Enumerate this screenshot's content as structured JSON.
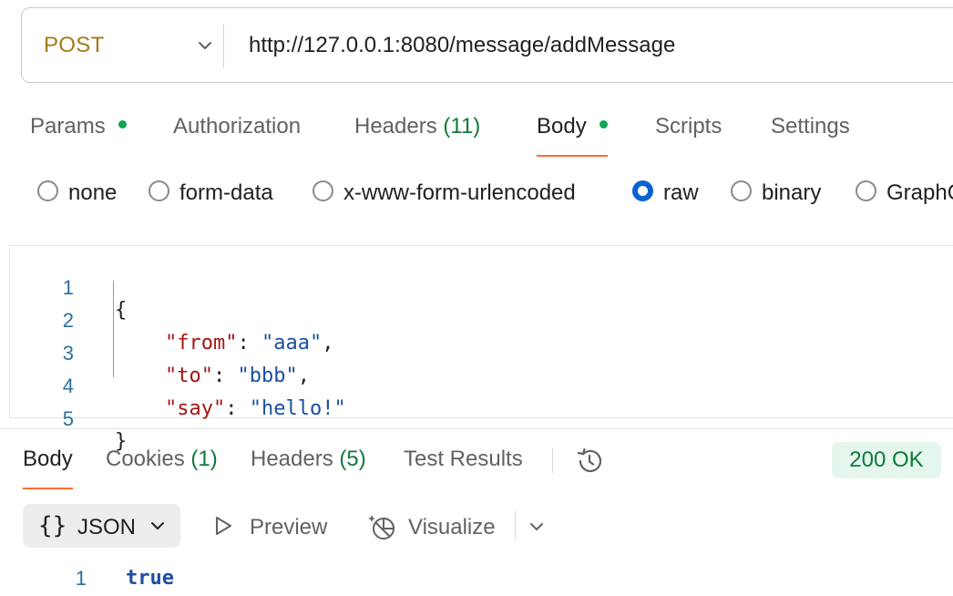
{
  "request": {
    "method": "POST",
    "url": "http://127.0.0.1:8080/message/addMessage"
  },
  "request_tabs": [
    {
      "label": "Params",
      "has_dot": true
    },
    {
      "label": "Authorization"
    },
    {
      "label": "Headers",
      "count": "(11)"
    },
    {
      "label": "Body",
      "has_dot": true,
      "active": true
    },
    {
      "label": "Scripts"
    },
    {
      "label": "Settings"
    }
  ],
  "body_types": [
    {
      "label": "none",
      "checked": false
    },
    {
      "label": "form-data",
      "checked": false
    },
    {
      "label": "x-www-form-urlencoded",
      "checked": false
    },
    {
      "label": "raw",
      "checked": true
    },
    {
      "label": "binary",
      "checked": false
    },
    {
      "label": "GraphQ",
      "checked": false
    }
  ],
  "editor": {
    "lines": [
      {
        "num": "1",
        "open": "{"
      },
      {
        "num": "2",
        "key": "\"from\"",
        "colon": ": ",
        "value": "\"aaa\"",
        "comma": ","
      },
      {
        "num": "3",
        "key": "\"to\"",
        "colon": ": ",
        "value": "\"bbb\"",
        "comma": ","
      },
      {
        "num": "4",
        "key": "\"say\"",
        "colon": ": ",
        "value": "\"hello!\"",
        "comma": ""
      },
      {
        "num": "5",
        "close": "}"
      }
    ]
  },
  "response_tabs": [
    {
      "label": "Body",
      "active": true
    },
    {
      "label": "Cookies",
      "count": "(1)"
    },
    {
      "label": "Headers",
      "count": "(5)"
    },
    {
      "label": "Test Results"
    }
  ],
  "response_status": "200 OK",
  "response_toolbar": {
    "format_braces": "{}",
    "format": "JSON",
    "preview": "Preview",
    "visualize": "Visualize"
  },
  "response_body": {
    "line_num": "1",
    "value": "true"
  },
  "icons": {
    "method_dropdown": "chevron-down-icon",
    "history": "history-icon",
    "preview": "play-outline-icon",
    "visualize": "visualize-icon",
    "more": "chevron-down-icon"
  },
  "colors": {
    "method": "#a57a1b",
    "active_tab_underline": "#ff6c37",
    "status_dot": "#11a653",
    "count_text": "#0f7a3a",
    "radio_checked": "#0b62cf",
    "json_key": "#a31515",
    "json_string": "#1c4fa0",
    "status_badge_bg": "#e5f6ec"
  }
}
